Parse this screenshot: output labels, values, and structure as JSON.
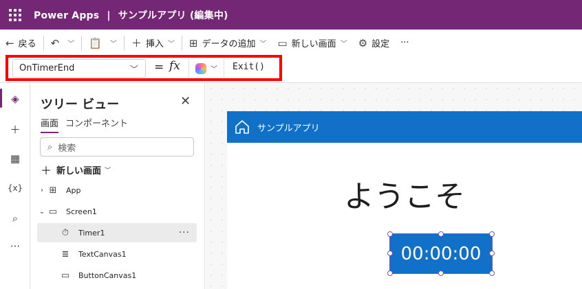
{
  "titlebar": {
    "app_name": "Power Apps",
    "separator": "|",
    "app_title": "サンプルアプリ (編集中)"
  },
  "commandbar": {
    "back": "戻る",
    "insert": "挿入",
    "add_data": "データの追加",
    "new_screen": "新しい画面",
    "settings": "設定",
    "more": "···"
  },
  "formula_bar": {
    "property": "OnTimerEnd",
    "equals": "=",
    "fx": "fx",
    "formula": "Exit()"
  },
  "tree_view": {
    "title": "ツリー ビュー",
    "tabs": [
      "画面",
      "コンポーネント"
    ],
    "search_placeholder": "検索",
    "new_screen": "新しい画面",
    "nodes": [
      {
        "label": "App",
        "icon": "app-icon"
      },
      {
        "label": "Screen1",
        "icon": "screen-icon"
      },
      {
        "label": "Timer1",
        "icon": "timer-icon"
      },
      {
        "label": "TextCanvas1",
        "icon": "text-icon"
      },
      {
        "label": "ButtonCanvas1",
        "icon": "button-icon"
      }
    ]
  },
  "screen": {
    "header_title": "サンプルアプリ",
    "welcome_text": "ようこそ",
    "timer_text": "00:00:00"
  },
  "colors": {
    "brand": "#742774",
    "header": "#1170c7",
    "highlight": "#ff0000"
  }
}
